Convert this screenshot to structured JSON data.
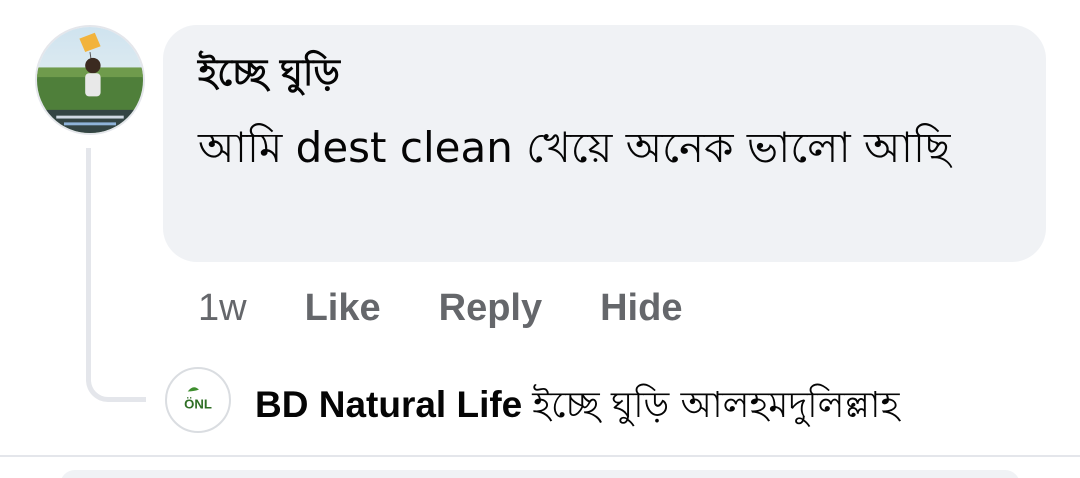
{
  "comment": {
    "author": "ইচ্ছে ঘুড়ি",
    "text": "আমি dest clean খেয়ে অনেক ভালো আছি",
    "avatar_icon": "profile-photo-kite-child"
  },
  "actions": {
    "time": "1w",
    "like": "Like",
    "reply": "Reply",
    "hide": "Hide"
  },
  "reply": {
    "author": "BD Natural Life",
    "mention": "ইচ্ছে ঘুড়ি",
    "text": "আলহমদুলিল্লাহ",
    "avatar_text": "ÖNL",
    "avatar_icon": "bd-natural-life-logo"
  },
  "colors": {
    "bubble": "#f0f2f5",
    "secondary_text": "#65676b",
    "thread_line": "#e4e6eb",
    "logo_green": "#3e8e2e"
  }
}
